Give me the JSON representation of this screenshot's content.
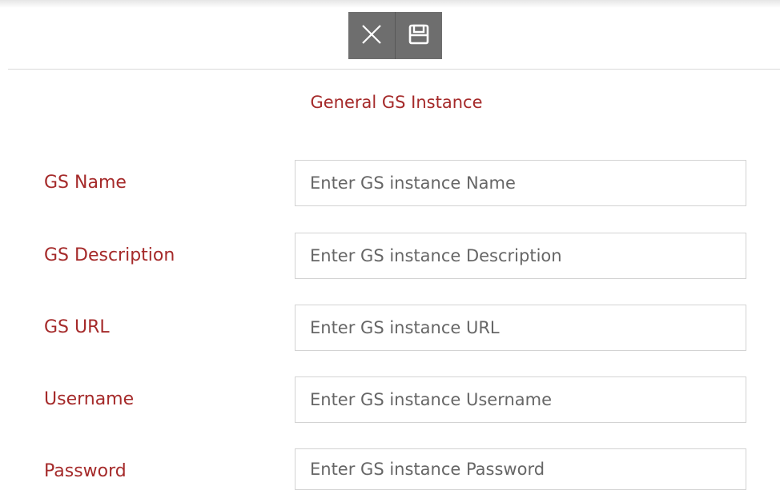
{
  "toolbar": {
    "close_icon": "close-icon",
    "save_icon": "floppy-save-icon",
    "background_color": "#6e6e6e"
  },
  "form": {
    "title": "General GS Instance",
    "accent_color": "#a52a2a",
    "fields": [
      {
        "label": "GS Name",
        "value": "",
        "placeholder": "Enter GS instance Name"
      },
      {
        "label": "GS Description",
        "value": "",
        "placeholder": "Enter GS instance Description"
      },
      {
        "label": "GS URL",
        "value": "",
        "placeholder": "Enter GS instance URL"
      },
      {
        "label": "Username",
        "value": "",
        "placeholder": "Enter GS instance Username"
      },
      {
        "label": "Password",
        "value": "",
        "placeholder": "Enter GS instance Password"
      }
    ]
  }
}
